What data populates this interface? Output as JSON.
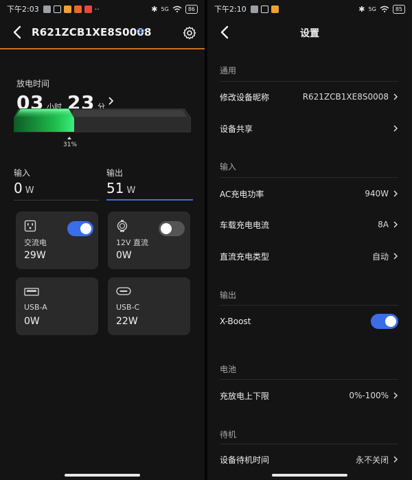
{
  "left": {
    "status": {
      "time": "下午2:03",
      "battery": "86",
      "network": "5G"
    },
    "device_name": "R621ZCB1XE8S0008",
    "discharge": {
      "label": "放电时间",
      "hours": "03",
      "hours_unit": "小时",
      "minutes": "23",
      "minutes_unit": "分",
      "battery_percent": "31%",
      "battery_level": 0.31
    },
    "input": {
      "label": "输入",
      "value": "0",
      "unit": "W"
    },
    "output": {
      "label": "输出",
      "value": "51",
      "unit": "W"
    },
    "cards": [
      {
        "name": "交流电",
        "value": "29W",
        "icon": "ac-outlet-icon",
        "toggle": "on"
      },
      {
        "name": "12V 直流",
        "value": "0W",
        "icon": "dc-car-port-icon",
        "toggle": "off"
      },
      {
        "name": "USB-A",
        "value": "0W",
        "icon": "usb-a-port-icon"
      },
      {
        "name": "USB-C",
        "value": "22W",
        "icon": "usb-c-port-icon"
      }
    ]
  },
  "right": {
    "status": {
      "time": "下午2:10",
      "battery": "85",
      "network": "5G"
    },
    "title": "设置",
    "sections": {
      "general": "通用",
      "input": "输入",
      "output": "输出",
      "battery": "电池",
      "standby": "待机"
    },
    "rows": {
      "rename": {
        "label": "修改设备昵称",
        "value": "R621ZCB1XE8S0008"
      },
      "share": {
        "label": "设备共享",
        "value": ""
      },
      "ac_power": {
        "label": "AC充电功率",
        "value": "940W"
      },
      "car_current": {
        "label": "车载充电电流",
        "value": "8A"
      },
      "dc_type": {
        "label": "直流充电类型",
        "value": "自动"
      },
      "xboost": {
        "label": "X-Boost",
        "enabled": true
      },
      "charge_limit": {
        "label": "充放电上下限",
        "value": "0%-100%"
      },
      "standby_time": {
        "label": "设备待机时间",
        "value": "永不关闭"
      }
    }
  },
  "colors": {
    "accent_blue": "#3a6ee8",
    "accent_orange": "#c8702a",
    "battery_green": "#22c55e",
    "card_bg": "#2a2a2a",
    "panel_bg": "#141414"
  }
}
